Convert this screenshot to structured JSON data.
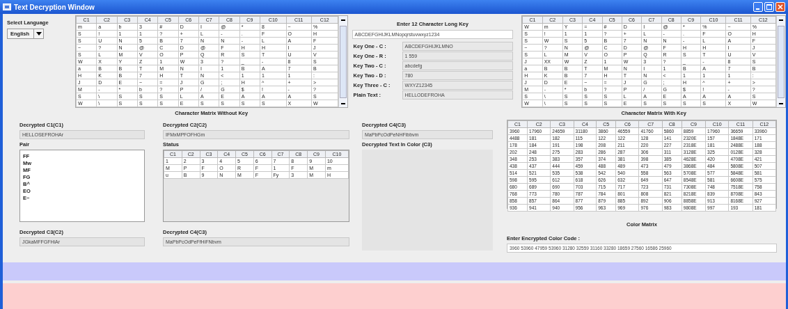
{
  "window": {
    "title": "Text Decryption Window"
  },
  "language": {
    "label": "Select Language",
    "value": "English"
  },
  "matrix_without_key": {
    "caption": "Character Matrix Without Key",
    "columns": [
      "C1",
      "C2",
      "C3",
      "C4",
      "C5",
      "C6",
      "C7",
      "C8",
      "C9",
      "C10",
      "C11",
      "C12"
    ],
    "rows": [
      [
        "m",
        "a",
        "b",
        "3",
        "#",
        "D",
        "I",
        "@",
        "*",
        "8",
        "~",
        "%"
      ],
      [
        "S",
        "!",
        "1",
        "1",
        "?",
        "+",
        "L",
        "-",
        ".",
        "F",
        "O",
        "H"
      ],
      [
        "S",
        "U",
        "N",
        "5",
        "B",
        "7",
        "N",
        "N",
        "-",
        "L",
        "A",
        "F"
      ],
      [
        "~",
        "?",
        "N",
        "@",
        "C",
        "D",
        "@",
        "F",
        "H",
        "H",
        "I",
        "J"
      ],
      [
        "S",
        "L",
        "M",
        "V",
        "O",
        "P",
        "Q",
        "R",
        "S",
        "T",
        "U",
        "V"
      ],
      [
        "W",
        "X",
        "Y",
        "Z",
        "1",
        "W",
        "3",
        "?",
        "_",
        "-",
        "8",
        "S"
      ],
      [
        "a",
        "B",
        "B",
        "T",
        "M",
        "N",
        "I",
        "1",
        "B",
        "A",
        "7",
        "B"
      ],
      [
        "H",
        "K",
        "B",
        "7",
        "H",
        "T",
        "N",
        "<",
        "1",
        "1",
        "1",
        ":"
      ],
      [
        "J",
        "D",
        "E",
        "~",
        "=",
        "J",
        "G",
        ";",
        "H",
        "^",
        "+",
        ">"
      ],
      [
        "M",
        "-",
        "*",
        "b",
        "?",
        "P",
        "/",
        "G",
        "$",
        "!",
        "-",
        "?"
      ],
      [
        "S",
        "\\",
        "S",
        "S",
        "S",
        "L",
        "A",
        "E",
        "A",
        "A",
        "A",
        "S"
      ],
      [
        "W",
        "\\",
        "S",
        "S",
        "S",
        "E",
        "S",
        "S",
        "S",
        "S",
        "X",
        "W"
      ]
    ]
  },
  "key_panel": {
    "heading": "Enter 12 Character Long Key",
    "key": "ABCDEFGHIJKLMNopqrstuvwxyz1234",
    "fields": [
      {
        "label": "Key One - C :",
        "value": "ABCDEFGHIJKLMNO"
      },
      {
        "label": "Key One - R :",
        "value": "1 559"
      },
      {
        "label": "Key Two - C :",
        "value": "abcdefg"
      },
      {
        "label": "Key Two - D :",
        "value": "780"
      },
      {
        "label": "Key Three - C :",
        "value": "WXYZ12345"
      },
      {
        "label": "Plain Text :",
        "value": "HELLODEFROHA"
      }
    ]
  },
  "matrix_with_key": {
    "caption": "Character Matrix With Key",
    "columns": [
      "C1",
      "C2",
      "C3",
      "C4",
      "C5",
      "C6",
      "C7",
      "C8",
      "C9",
      "C10",
      "C11",
      "C12"
    ],
    "rows": [
      [
        "W",
        "m",
        "Y",
        "=",
        "#",
        "D",
        "I",
        "@",
        "*",
        "%",
        "~",
        "%"
      ],
      [
        "S",
        "!",
        "1",
        "1",
        "?",
        "+",
        "L",
        "-",
        ".",
        "F",
        "O",
        "H"
      ],
      [
        "S",
        "W",
        "S",
        "5",
        "B",
        "7",
        "N",
        "N",
        "-",
        "L",
        "A",
        "F"
      ],
      [
        "~",
        "?",
        "N",
        "@",
        "C",
        "D",
        "@",
        "F",
        "H",
        "H",
        "I",
        "J"
      ],
      [
        "S",
        "L",
        "M",
        "V",
        "O",
        "P",
        "Q",
        "R",
        "S",
        "T",
        "U",
        "V"
      ],
      [
        "J",
        "XX",
        "W",
        "Z",
        "1",
        "W",
        "3",
        "?",
        "_",
        "-",
        "8",
        "S"
      ],
      [
        "a",
        "B",
        "B",
        "T",
        "M",
        "N",
        "I",
        "1",
        "B",
        "A",
        "7",
        "B"
      ],
      [
        "H",
        "K",
        "B",
        "7",
        "H",
        "T",
        "N",
        "<",
        "1",
        "1",
        "1",
        ":"
      ],
      [
        "J",
        "D",
        "E",
        "~",
        "=",
        "J",
        "G",
        ";",
        "H",
        "^",
        "+",
        ">"
      ],
      [
        "M",
        "-",
        "*",
        "b",
        "?",
        "P",
        "/",
        "G",
        "$",
        "!",
        "-",
        "?"
      ],
      [
        "S",
        "\\",
        "S",
        "S",
        "S",
        "L",
        "A",
        "E",
        "A",
        "A",
        "A",
        "S"
      ],
      [
        "W",
        "\\",
        "S",
        "S",
        "S",
        "E",
        "S",
        "S",
        "S",
        "S",
        "X",
        "W"
      ]
    ]
  },
  "decrypted_c1": {
    "label": "Decrypted C1(C1)",
    "value": "HELLOSEFROHAr"
  },
  "pair": {
    "label": "Pair",
    "items": [
      "FF",
      "Mw",
      "MF",
      "FG",
      "B^",
      "EO",
      "E~"
    ]
  },
  "decrypted_c3": {
    "label": "Decrypted C3(C2)",
    "value": "JGkaMFFGFHiAr"
  },
  "decrypted_c2": {
    "label": "Decrypted C2(C2)",
    "value": "IFMxMPFOFHGm"
  },
  "status": {
    "label": "Status",
    "columns": [
      "C1",
      "C2",
      "C3",
      "C4",
      "C5",
      "C6",
      "C7",
      "C8",
      "C9",
      "C10"
    ],
    "rows": [
      [
        "1",
        "2",
        "3",
        "4",
        "5",
        "6",
        "7",
        "8",
        "9",
        "10"
      ],
      [
        "M",
        "P",
        "F",
        "O",
        "R",
        "F",
        "1",
        "F",
        "M",
        "m"
      ],
      [
        "u",
        "B",
        "9",
        "N",
        "M",
        "F",
        "Fy",
        "3",
        "M",
        "H"
      ]
    ]
  },
  "decrypted_c4b": {
    "label": "Decrypted C4(C3)",
    "value": "MaPbPcOdPeFfHiFNbvm"
  },
  "decrypted_c4": {
    "label": "Decrypted C4(C3)",
    "value": "MaPbPcOdPeNHFibbvm"
  },
  "color_text": {
    "label": "Decrypted Text In Color (C3)"
  },
  "color_matrix": {
    "caption": "Color Matrix",
    "columns": [
      "C1",
      "C2",
      "C3",
      "C4",
      "C5",
      "C6",
      "C7",
      "C8",
      "C9",
      "C10",
      "C11",
      "C12"
    ],
    "rows": [
      [
        "3960",
        "17960",
        "24659",
        "31180",
        "3860",
        "46559",
        "41760",
        "5860",
        "8859",
        "17960",
        "36659",
        "33960"
      ],
      [
        "4488",
        "181",
        "182",
        "115",
        "122",
        "122",
        "128",
        "141",
        "2320E",
        "157",
        "1848E",
        "171"
      ],
      [
        "178",
        "184",
        "191",
        "198",
        "208",
        "211",
        "220",
        "227",
        "2318E",
        "181",
        "2488E",
        "188"
      ],
      [
        "202",
        "248",
        "275",
        "283",
        "286",
        "287",
        "306",
        "311",
        "3128E",
        "325",
        "0128E",
        "328"
      ],
      [
        "348",
        "253",
        "383",
        "357",
        "374",
        "381",
        "398",
        "385",
        "4628E",
        "420",
        "4708E",
        "421"
      ],
      [
        "438",
        "437",
        "444",
        "459",
        "488",
        "489",
        "473",
        "479",
        "3868E",
        "484",
        "5808E",
        "507"
      ],
      [
        "514",
        "521",
        "535",
        "538",
        "542",
        "540",
        "558",
        "563",
        "5708E",
        "577",
        "5848E",
        "581"
      ],
      [
        "598",
        "595",
        "612",
        "618",
        "626",
        "632",
        "649",
        "647",
        "8548E",
        "581",
        "6608E",
        "575"
      ],
      [
        "680",
        "689",
        "690",
        "703",
        "715",
        "717",
        "723",
        "731",
        "7308E",
        "748",
        "7518E",
        "758"
      ],
      [
        "768",
        "773",
        "780",
        "787",
        "784",
        "801",
        "808",
        "821",
        "8218E",
        "839",
        "8708E",
        "843"
      ],
      [
        "858",
        "857",
        "864",
        "877",
        "879",
        "885",
        "892",
        "906",
        "8858E",
        "913",
        "8168E",
        "927"
      ],
      [
        "936",
        "941",
        "940",
        "956",
        "963",
        "969",
        "976",
        "983",
        "9808E",
        "997",
        "193",
        "181"
      ]
    ]
  },
  "color_code": {
    "label": "Enter Encrypted Color Code :",
    "value": "3960 53960 47959 53960 31280 32559 31160 33280 18659 27560 16586 25960"
  }
}
